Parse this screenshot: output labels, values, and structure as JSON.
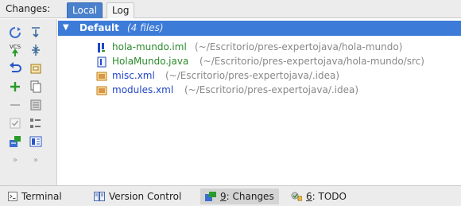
{
  "header": {
    "label": "Changes:",
    "tabs": [
      {
        "label": "Local",
        "active": true
      },
      {
        "label": "Log",
        "active": false
      }
    ]
  },
  "toolbar": {
    "left_column": [
      "refresh-icon",
      "vcs-update-icon",
      "rollback-icon",
      "add-icon",
      "minus-icon",
      "checkbox-icon",
      "shelve-icon",
      "more-icon"
    ],
    "right_column": [
      "expand-all-icon",
      "collapse-all-icon",
      "changelist-icon",
      "copy-icon",
      "diff-icon",
      "group-by-icon",
      "preview-icon",
      "more-icon"
    ],
    "more_glyph": "»"
  },
  "tree": {
    "group": {
      "name": "Default",
      "count": "(4 files)"
    },
    "files": [
      {
        "name": "hola-mundo.iml",
        "path": "(~/Escritorio/pres-expertojava/hola-mundo)",
        "color": "#2a8a2a",
        "icon": "iml-file-icon"
      },
      {
        "name": "HolaMundo.java",
        "path": "(~/Escritorio/pres-expertojava/hola-mundo/src)",
        "color": "#2a8a2a",
        "icon": "java-file-icon"
      },
      {
        "name": "misc.xml",
        "path": "(~/Escritorio/pres-expertojava/.idea)",
        "color": "#2146c8",
        "icon": "xml-file-icon"
      },
      {
        "name": "modules.xml",
        "path": "(~/Escritorio/pres-expertojava/.idea)",
        "color": "#2146c8",
        "icon": "xml-file-icon"
      }
    ]
  },
  "statusbar": {
    "terminal": "Terminal",
    "version_control": "Version Control",
    "changes_num": "9",
    "changes_rest": ": Changes",
    "todo_num": "6",
    "todo_rest": ": TODO"
  },
  "colors": {
    "accent": "#3d7bd8",
    "added_file": "#2a8a2a",
    "modified_file": "#2146c8"
  }
}
